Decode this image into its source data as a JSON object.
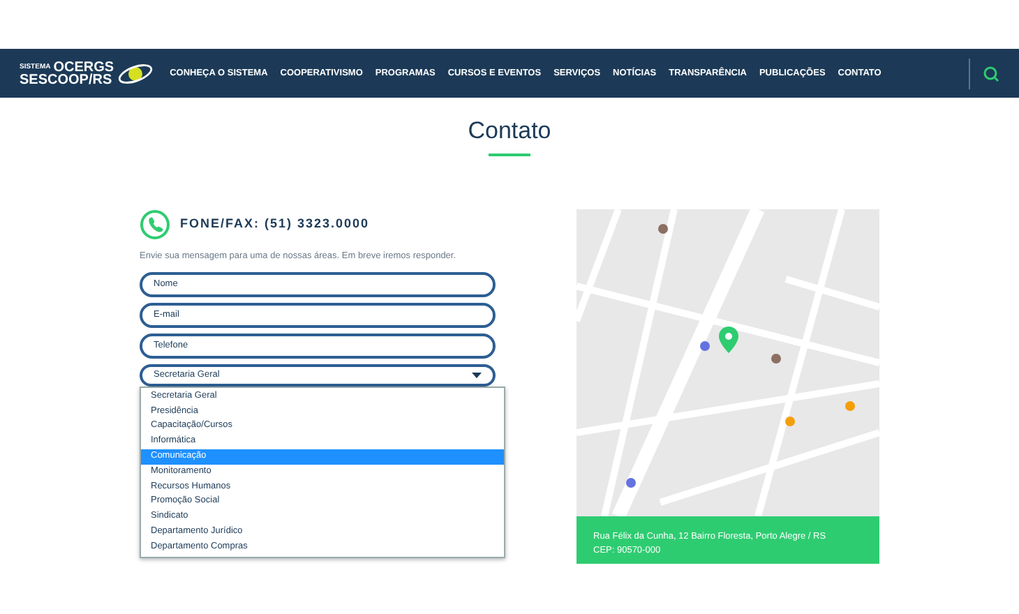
{
  "logo": {
    "small": "SISTEMA",
    "top": "OCERGS",
    "bottom": "SESCOOP/RS"
  },
  "nav": {
    "items": [
      "CONHEÇA O SISTEMA",
      "COOPERATIVISMO",
      "PROGRAMAS",
      "CURSOS E EVENTOS",
      "SERVIÇOS",
      "NOTÍCIAS",
      "TRANSPARÊNCIA",
      "PUBLICAÇÕES",
      "CONTATO"
    ]
  },
  "title": "Contato",
  "phone": "FONE/FAX: (51) 3323.0000",
  "intro": "Envie sua mensagem para uma de nossas áreas. Em breve iremos responder.",
  "fields": [
    {
      "placeholder": "Nome"
    },
    {
      "placeholder": "E-mail"
    },
    {
      "placeholder": "Telefone"
    }
  ],
  "select": {
    "value": "Secretaria Geral",
    "expanded": true,
    "options": [
      {
        "label": "Secretaria Geral",
        "highlighted": false
      },
      {
        "label": "Presidência",
        "highlighted": false
      },
      {
        "label": "Capacitação/Cursos",
        "highlighted": false
      },
      {
        "label": "Informática",
        "highlighted": false
      },
      {
        "label": "Comunicação",
        "highlighted": true
      },
      {
        "label": "Monitoramento",
        "highlighted": false
      },
      {
        "label": "Recursos Humanos",
        "highlighted": false
      },
      {
        "label": "Promoção Social",
        "highlighted": false
      },
      {
        "label": "Sindicato",
        "highlighted": false
      },
      {
        "label": "Departamento Jurídico",
        "highlighted": false
      },
      {
        "label": "Departamento Compras",
        "highlighted": false
      }
    ]
  },
  "address": [
    "Rua Félix da Cunha, 12 Bairro Floresta, Porto Alegre / RS",
    "CEP: 90570-000"
  ]
}
